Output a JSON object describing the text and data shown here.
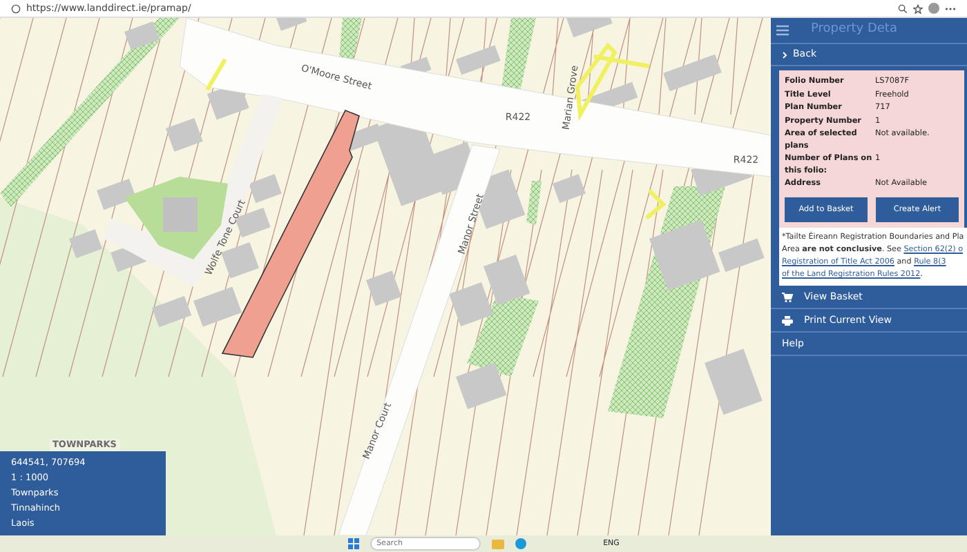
{
  "browser": {
    "url": "https://www.landdirect.ie/pramap/"
  },
  "map": {
    "street_labels": [
      "O'Moore Street",
      "R422",
      "R422",
      "Manor Street",
      "Wolfe Tone Court",
      "Marian Grove",
      "Manor Court"
    ],
    "area_label": "TOWNPARKS",
    "info": [
      "644541, 707694",
      "1 : 1000",
      "Townparks",
      "Tinnahinch",
      "Laois"
    ]
  },
  "panel": {
    "title": "Property Deta",
    "back": "Back",
    "details": [
      {
        "label": "Folio Number",
        "value": "LS7087F"
      },
      {
        "label": "Title Level",
        "value": "Freehold"
      },
      {
        "label": "Plan Number",
        "value": "717"
      },
      {
        "label": "Property Number",
        "value": "1"
      },
      {
        "label": "Area of selected plans",
        "value": "Not available."
      },
      {
        "label": "Number of Plans on this folio:",
        "value": "1"
      },
      {
        "label": "Address",
        "value": "Not Available"
      }
    ],
    "buttons": [
      "Add to Basket",
      "Create Alert"
    ],
    "disclaimer": [
      [
        {
          "kind": "text",
          "text": "*Tailte Éireann Registration Boundaries and Pla"
        }
      ],
      [
        {
          "kind": "text",
          "text": "Area "
        },
        {
          "kind": "bold",
          "text": "are not conclusive"
        },
        {
          "kind": "text",
          "text": ". See "
        },
        {
          "kind": "link",
          "text": "Section 62(2) o"
        }
      ],
      [
        {
          "kind": "link",
          "text": "Registration of Title Act 2006"
        },
        {
          "kind": "text",
          "text": " and "
        },
        {
          "kind": "link",
          "text": "Rule 8(3"
        }
      ],
      [
        {
          "kind": "link",
          "text": "of the Land Registration Rules 2012"
        },
        {
          "kind": "text",
          "text": "."
        }
      ]
    ],
    "menu": [
      {
        "label": "View Basket",
        "kind": "cart"
      },
      {
        "label": "Print Current View",
        "kind": "printer"
      },
      {
        "label": "Help",
        "kind": "plain"
      }
    ]
  },
  "taskbar": {
    "search_placeholder": "Search",
    "language": "ENG"
  }
}
